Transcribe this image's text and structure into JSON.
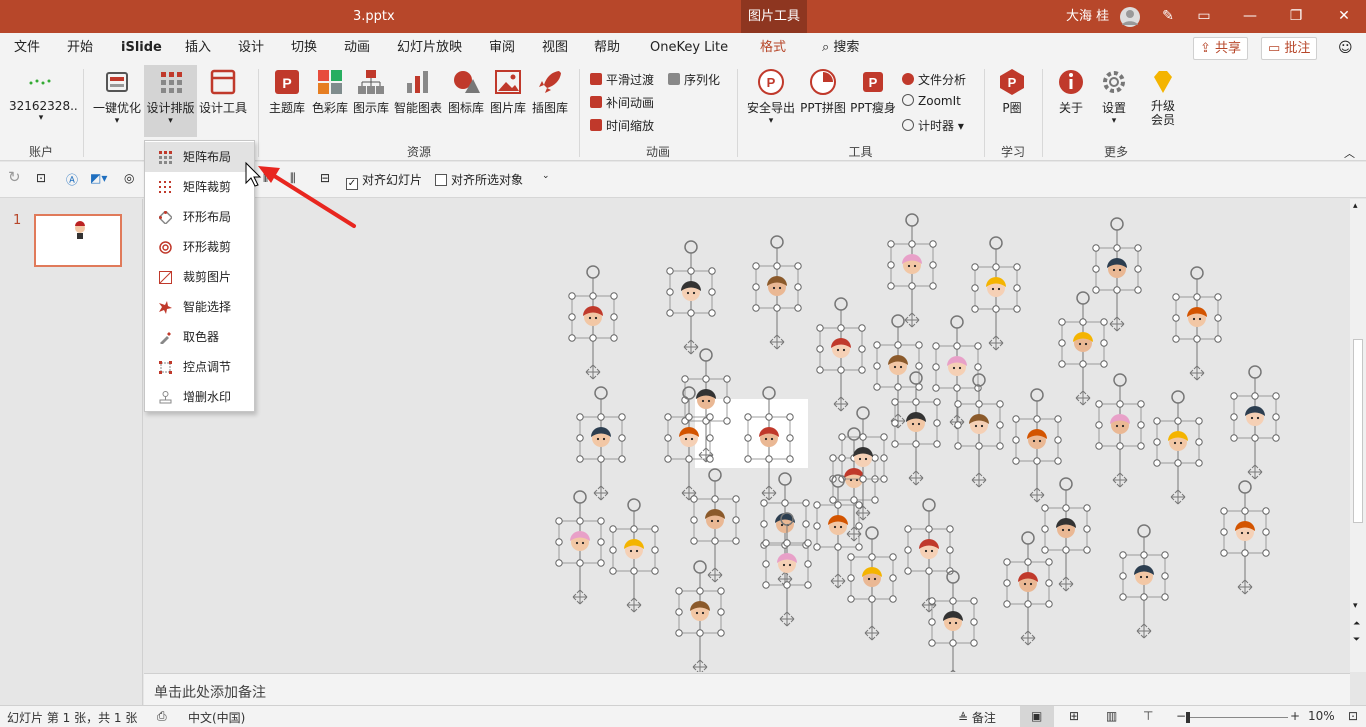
{
  "titlebar": {
    "filename": "3.pptx",
    "context_tab": "图片工具",
    "user": "大海 桂"
  },
  "tabs": [
    "文件",
    "开始",
    "iSlide",
    "插入",
    "设计",
    "切换",
    "动画",
    "幻灯片放映",
    "审阅",
    "视图",
    "帮助",
    "OneKey Lite",
    "格式"
  ],
  "search_label": "搜索",
  "share_label": "共享",
  "comment_label": "批注",
  "ribbon": {
    "account": {
      "value": "32162328..",
      "group": "账户"
    },
    "optimize": {
      "label": "一键优化"
    },
    "layout": {
      "label": "设计排版"
    },
    "tools": {
      "label": "设计工具"
    },
    "resource_items": [
      "主题库",
      "色彩库",
      "图示库",
      "智能图表",
      "图标库",
      "图片库",
      "插图库"
    ],
    "resource_group": "资源",
    "anim_items": [
      "平滑过渡",
      "序列化",
      "补间动画",
      "时间缩放"
    ],
    "anim_group": "动画",
    "tool_items": [
      "安全导出",
      "PPT拼图",
      "PPT瘦身"
    ],
    "tool_small": [
      "文件分析",
      "ZoomIt",
      "计时器"
    ],
    "tool_group": "工具",
    "learn": {
      "label": "P圈",
      "group": "学习"
    },
    "more_items": [
      "关于",
      "设置",
      "升级会员"
    ],
    "more_group": "更多"
  },
  "toolbar2": {
    "align_slide": "对齐幻灯片",
    "align_selected": "对齐所选对象",
    "align_slide_checked": true,
    "align_selected_checked": false
  },
  "dropdown": [
    "矩阵布局",
    "矩阵裁剪",
    "环形布局",
    "环形裁剪",
    "裁剪图片",
    "智能选择",
    "取色器",
    "控点调节",
    "增删水印"
  ],
  "slide_number": "1",
  "notes_placeholder": "单击此处添加备注",
  "status": {
    "slide_info": "幻灯片 第 1 张，共 1 张",
    "language": "中文(中国)",
    "notes": "备注",
    "zoom": "10%"
  },
  "colors": {
    "brand": "#b7472a",
    "context_tab": "#8e3620"
  }
}
